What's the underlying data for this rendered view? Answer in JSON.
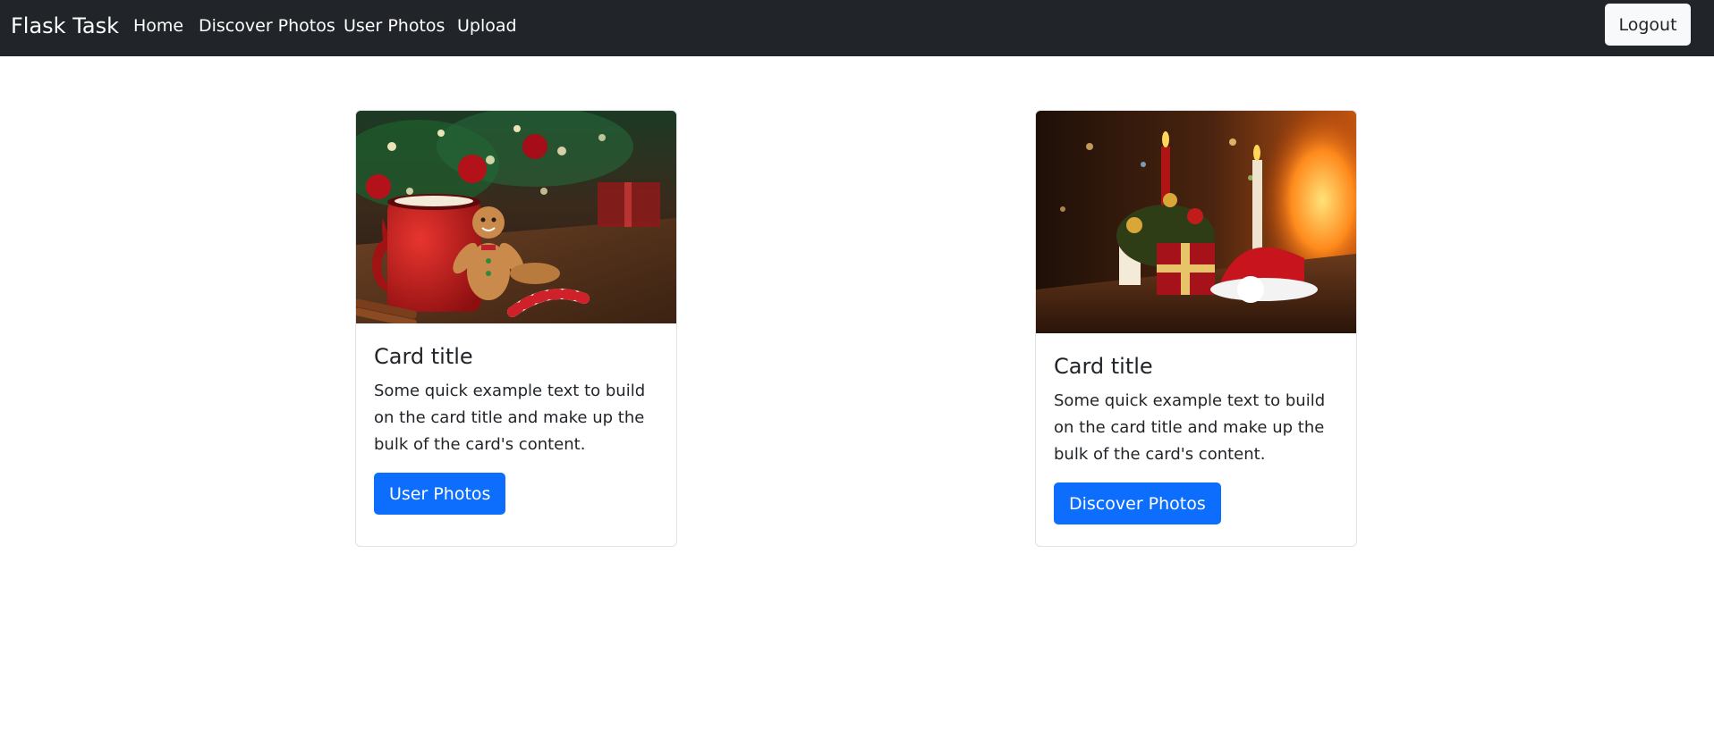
{
  "navbar": {
    "brand": "Flask Task",
    "links": {
      "home": "Home",
      "discover": "Discover Photos",
      "user_photos": "User Photos",
      "upload": "Upload"
    },
    "logout": "Logout"
  },
  "cards": [
    {
      "image_icon": "christmas-mug-photo",
      "title": "Card title",
      "text": "Some quick example text to build on the card title and make up the bulk of the card's content.",
      "button": "User Photos"
    },
    {
      "image_icon": "christmas-candles-photo",
      "title": "Card title",
      "text": "Some quick example text to build on the card title and make up the bulk of the card's content.",
      "button": "Discover Photos"
    }
  ],
  "colors": {
    "navbar_bg": "#212529",
    "primary": "#0d6efd",
    "light": "#f8f9fa",
    "card_border": "#dfe2e6"
  }
}
